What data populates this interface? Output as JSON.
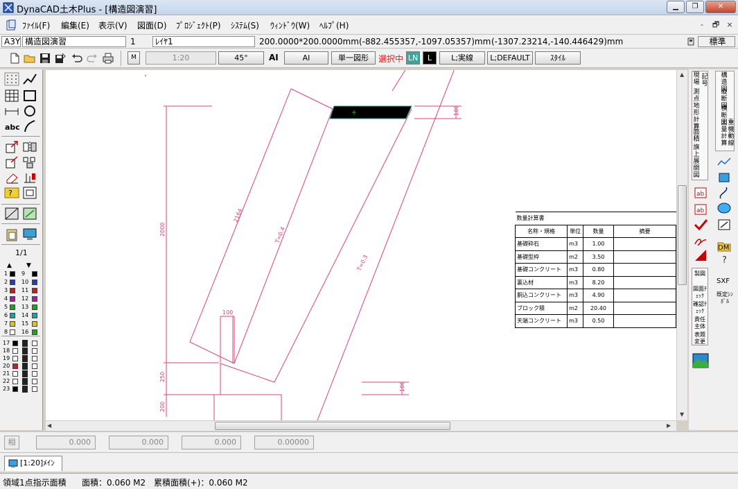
{
  "window": {
    "title": "DynaCAD土木Plus - [構造図演習]",
    "controls": [
      "minimize",
      "restore",
      "close"
    ]
  },
  "menu": {
    "items": [
      "ﾌｧｲﾙ(F)",
      "編集(E)",
      "表示(V)",
      "図面(D)",
      "ﾌﾟﾛｼﾞｪｸﾄ(P)",
      "ｼｽﾃﾑ(S)",
      "ｳｨﾝﾄﾞｳ(W)",
      "ﾍﾙﾌﾟ(H)"
    ],
    "mdi_controls": [
      "-",
      "🗗",
      "×"
    ]
  },
  "infobar": {
    "paper": "A3Y",
    "drawing_name": "構造図演習",
    "layer_no": "1",
    "layer_name": "ﾚｲﾔ1",
    "grid": "200.0000*200.0000mm",
    "coord1": "(-882.455357,-1097.05357)mm",
    "coord2": "(-1307.23214,-140.446429)mm",
    "mode": "標準"
  },
  "toolbar": {
    "m_label": "M",
    "scale": "1:20",
    "angle": "45°",
    "ai_label": "AI",
    "ai_button": "AI",
    "single_shape": "単一図形",
    "selecting": "選択中",
    "ln": "LN",
    "l": "L",
    "linetype": "L;実線",
    "layer_default": "L;DEFAULT",
    "style": "ｽﾀｲﾙ"
  },
  "left_palette": {
    "page": "1/1",
    "layers_a": [
      {
        "n": "1",
        "m": "9",
        "c1": "#000000",
        "c2": "#000000"
      },
      {
        "n": "2",
        "m": "10",
        "c1": "#1f3fbf",
        "c2": "#1f3fbf"
      },
      {
        "n": "3",
        "m": "11",
        "c1": "#c02020",
        "c2": "#c02020"
      },
      {
        "n": "4",
        "m": "12",
        "c1": "#a020a0",
        "c2": "#a020a0"
      },
      {
        "n": "5",
        "m": "13",
        "c1": "#20a020",
        "c2": "#20a020"
      },
      {
        "n": "6",
        "m": "14",
        "c1": "#20a0a0",
        "c2": "#20a0a0"
      },
      {
        "n": "7",
        "m": "15",
        "c1": "#e0c020",
        "c2": "#e0c020"
      },
      {
        "n": "8",
        "m": "16",
        "c1": "#ffffff",
        "c2": "#20a020"
      }
    ],
    "layers_b": [
      {
        "n": "17",
        "c": "#000000"
      },
      {
        "n": "18",
        "c": "#ffffff"
      },
      {
        "n": "19",
        "c": "#ffffff"
      },
      {
        "n": "20",
        "c": "#c02020"
      },
      {
        "n": "21",
        "c": "#ffffff"
      },
      {
        "n": "22",
        "c": "#ffffff"
      },
      {
        "n": "23",
        "c": "#000000"
      }
    ]
  },
  "right_palette": {
    "col1": [
      "現場",
      "測点地形計算",
      "面積",
      "旗上",
      "展開図",
      "記号"
    ],
    "col2": [
      "構造図",
      "縦断図",
      "横断図",
      "土量計算",
      "重機動線"
    ],
    "dm": "DM",
    "check_labels": [
      "製図",
      "図面ﾁｪｯｸ",
      "確認ﾁｪｯｸ",
      "責任主体",
      "表題変更"
    ],
    "sxf": "SXF",
    "sxf_sub": "既定ｼﾝﾎﾞﾙ"
  },
  "drawing": {
    "dims": {
      "d2000": "2000",
      "d2164": "2164",
      "d100a": "100",
      "d100b": "100",
      "d100c": "100",
      "d250": "250",
      "d200": "200",
      "t1": "T=0.4",
      "t2": "T=0.3"
    }
  },
  "quantity_table": {
    "title": "数量計算書",
    "headers": [
      "名称・規格",
      "単位",
      "数量",
      "摘要"
    ],
    "rows": [
      [
        "基礎砕石",
        "m3",
        "1.00",
        ""
      ],
      [
        "基礎型枠",
        "m2",
        "3.50",
        ""
      ],
      [
        "基礎コンクリート",
        "m3",
        "0.80",
        ""
      ],
      [
        "裏込材",
        "m3",
        "8.20",
        ""
      ],
      [
        "胴込コンクリート",
        "m3",
        "4.90",
        ""
      ],
      [
        "ブロック積",
        "m2",
        "20.40",
        ""
      ],
      [
        "天端コンクリート",
        "m3",
        "0.50",
        ""
      ]
    ]
  },
  "coordbar": {
    "rel": "相",
    "v1": "0.000",
    "v2": "0.000",
    "v3": "0.000",
    "v4": "0.00000"
  },
  "tab": {
    "label": "[1:20]ﾒｲﾝ"
  },
  "status": {
    "mode": "領域1点指示面積",
    "area": "面積：0.060 M2",
    "total": "累積面積(+)：0.060 M2"
  },
  "colors": {
    "dim_line": "#e0407a",
    "selection": "#000000"
  }
}
